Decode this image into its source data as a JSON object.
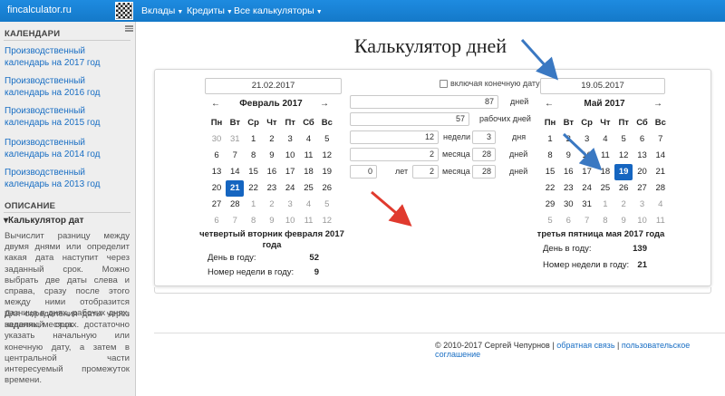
{
  "navbar": {
    "brand": "fincalculator.ru",
    "items": [
      {
        "label": "Вклады"
      },
      {
        "label": "Кредиты"
      },
      {
        "label": "Все калькуляторы"
      }
    ]
  },
  "sidebar": {
    "calendars_heading": "КАЛЕНДАРИ",
    "calendar_links": [
      "Производственный календарь на 2017 год",
      "Производственный календарь на 2016 год",
      "Производственный календарь на 2015 год",
      "Производственный календарь на 2014 год",
      "Производственный календарь на 2013 год"
    ],
    "description_heading": "ОПИСАНИЕ",
    "description_sub": "Калькулятор дат",
    "paragraph1": "Вычислит разницу между двумя днями или определит какая дата наступит через заданный срок. Можно выбрать две даты слева и справа, сразу после этого между ними отобразится разница в днях, рабочих днях, неделях, месяцах.",
    "paragraph2": "Для определения даты через заданный срок достаточно указать начальную или конечную дату, а затем в центральной части интересуемый промежуток времени."
  },
  "page": {
    "title": "Калькулятор дней"
  },
  "left": {
    "date": "21.02.2017",
    "month_title": "Февраль 2017",
    "prev": "←",
    "next": "→",
    "caption": "четвертый вторник февраля 2017 года",
    "day_of_year_label": "День в году:",
    "day_of_year": "52",
    "week_label": "Номер недели в году:",
    "week": "9"
  },
  "right": {
    "date": "19.05.2017",
    "month_title": "Май 2017",
    "prev": "←",
    "next": "→",
    "caption": "третья пятница мая 2017 года",
    "day_of_year_label": "День в году:",
    "day_of_year": "139",
    "week_label": "Номер недели в году:",
    "week": "21"
  },
  "weekdays": [
    "Пн",
    "Вт",
    "Ср",
    "Чт",
    "Пт",
    "Сб",
    "Вс"
  ],
  "center": {
    "include_end_label": "включая конечную дату",
    "days_value": "87",
    "days_unit": "дней",
    "workdays_value": "57",
    "workdays_unit": "рабочих дней",
    "weeks_value": "12",
    "weeks_unit": "недели",
    "weeks_days_value": "3",
    "weeks_days_unit": "дня",
    "months_value": "2",
    "months_unit": "месяца",
    "months_days_value": "28",
    "months_days_unit": "дней",
    "years_value": "0",
    "years_unit": "лет",
    "years_months_value": "2",
    "years_months_unit": "месяца",
    "years_days_value": "28",
    "years_days_unit": "дней"
  },
  "footer": {
    "copyright": "© 2010-2017 Сергей Чепурнов | ",
    "feedback": "обратная связь",
    "separator": " | ",
    "agreement": "пользовательское соглашение"
  }
}
